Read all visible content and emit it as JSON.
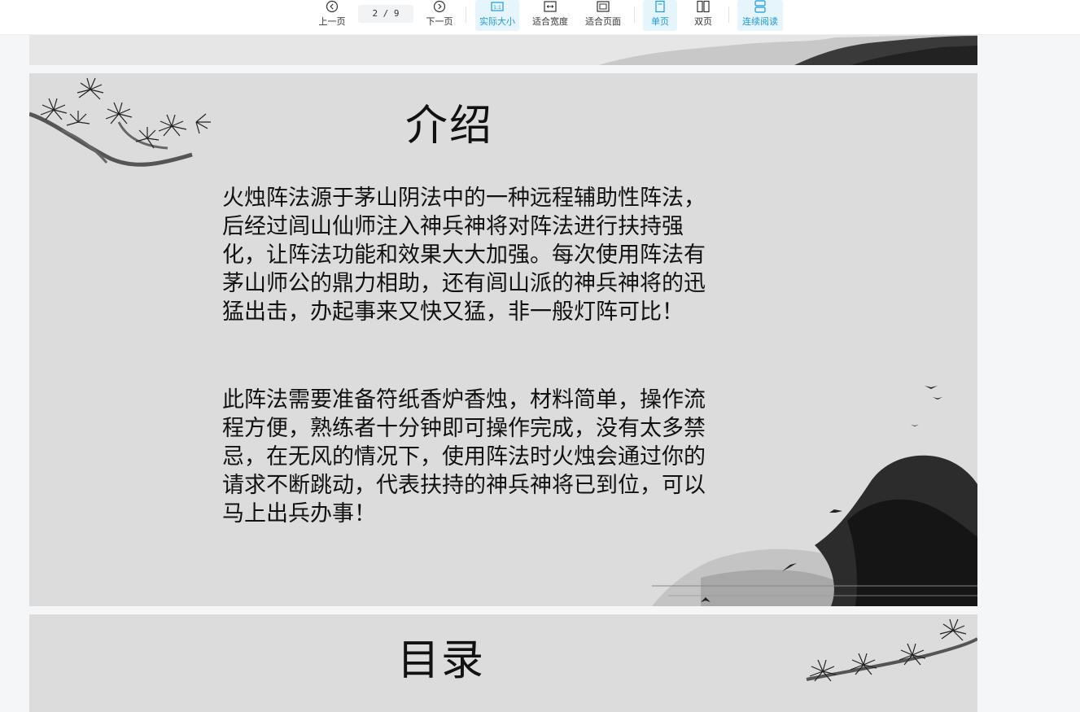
{
  "toolbar": {
    "prev_label": "上一页",
    "next_label": "下一页",
    "page_indicator": "2 / 9",
    "actual_size_label": "实际大小",
    "fit_width_label": "适合宽度",
    "fit_page_label": "适合页面",
    "single_page_label": "单页",
    "double_page_label": "双页",
    "continuous_label": "连续阅读",
    "active_color": "#1a9bd8"
  },
  "document": {
    "current_slide": {
      "title": "介绍",
      "paragraphs": [
        "火烛阵法源于茅山阴法中的一种远程辅助性阵法，后经过闾山仙师注入神兵神将对阵法进行扶持强化，让阵法功能和效果大大加强。每次使用阵法有茅山师公的鼎力相助，还有闾山派的神兵神将的迅猛出击，办起事来又快又猛，非一般灯阵可比！",
        "此阵法需要准备符纸香炉香烛，材料简单，操作流程方便，熟练者十分钟即可操作完成，没有太多禁忌，在无风的情况下，使用阵法时火烛会通过你的请求不断跳动，代表扶持的神兵神将已到位，可以马上出兵办事！"
      ]
    },
    "next_slide": {
      "title": "目录"
    }
  }
}
